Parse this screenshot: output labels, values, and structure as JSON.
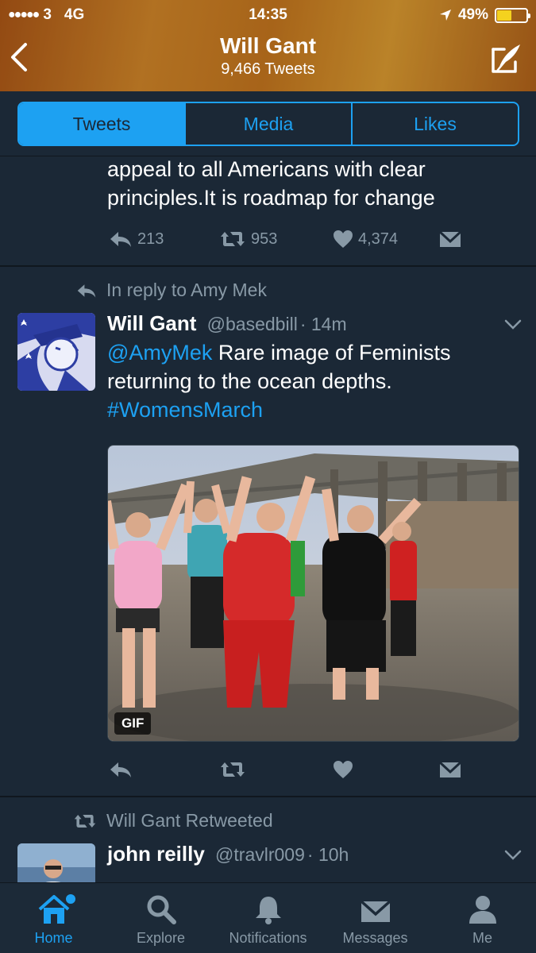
{
  "status_bar": {
    "carrier": "3",
    "network": "4G",
    "time": "14:35",
    "battery": "49%"
  },
  "header": {
    "title": "Will Gant",
    "subtitle": "9,466 Tweets"
  },
  "tabs": [
    {
      "label": "Tweets",
      "active": true
    },
    {
      "label": "Media",
      "active": false
    },
    {
      "label": "Likes",
      "active": false
    }
  ],
  "tweet1": {
    "text_line1": "appeal to all Americans with clear",
    "text_line2": "principles.It is roadmap for change",
    "replies": "213",
    "retweets": "953",
    "likes": "4,374"
  },
  "tweet2": {
    "context": "In reply to Amy Mek",
    "name": "Will Gant",
    "handle": "@basedbill",
    "time": "· 14m",
    "mention": "@AmyMek",
    "text_a": " Rare image of Feminists",
    "text_b": "returning to the ocean depths.",
    "hashtag": "#WomensMarch",
    "gif_label": "GIF"
  },
  "tweet3": {
    "context": "Will Gant Retweeted",
    "name": "john reilly",
    "handle": "@travlr009",
    "time": "· 10h"
  },
  "tabbar": [
    {
      "label": "Home",
      "icon": "home-icon",
      "active": true
    },
    {
      "label": "Explore",
      "icon": "search-icon",
      "active": false
    },
    {
      "label": "Notifications",
      "icon": "bell-icon",
      "active": false
    },
    {
      "label": "Messages",
      "icon": "envelope-icon",
      "active": false
    },
    {
      "label": "Me",
      "icon": "person-icon",
      "active": false
    }
  ],
  "colors": {
    "accent": "#1da1f2",
    "background": "#1b2836",
    "muted": "#8899a6"
  }
}
